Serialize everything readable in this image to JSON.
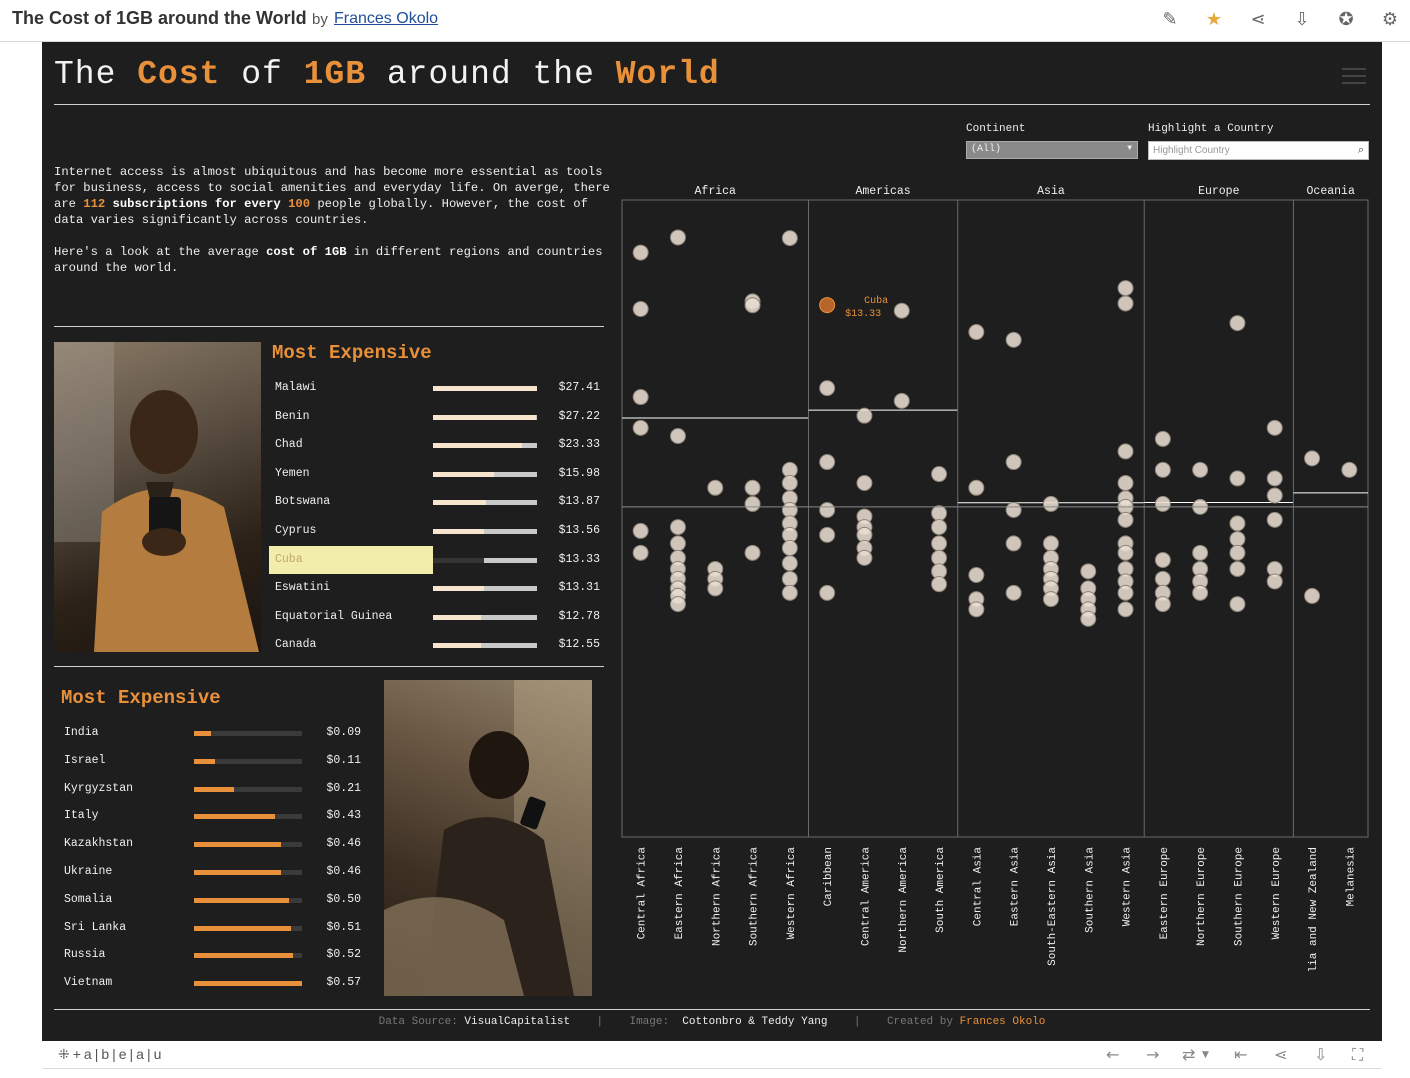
{
  "header": {
    "title": "The Cost of 1GB around the World",
    "by": "by",
    "author": "Frances Okolo"
  },
  "toolbar_icons": [
    "edit-icon",
    "star-icon",
    "share-icon",
    "download-icon",
    "badge-icon",
    "gear-icon"
  ],
  "dashboard": {
    "title_parts": [
      {
        "text": "The ",
        "hl": false
      },
      {
        "text": "Cost",
        "hl": true
      },
      {
        "text": " of ",
        "hl": false
      },
      {
        "text": "1GB",
        "hl": true
      },
      {
        "text": " around the ",
        "hl": false
      },
      {
        "text": "World",
        "hl": true
      }
    ],
    "intro_1": "Internet access is almost ubiquitous and has become more essential as tools for business, access to social amenities and everyday life. On averge, there are ",
    "intro_num1": "112",
    "intro_mid": " subscriptions for every ",
    "intro_num2": "100",
    "intro_2": " people globally. However, the cost of data varies significantly across countries.",
    "intro_3a": "Here's a look at the average ",
    "intro_3b": "cost of 1GB",
    "intro_3c": " in different regions and countries around the world.",
    "filters": {
      "continent_label": "Continent",
      "continent_value": "(All)",
      "highlight_label": "Highlight a Country",
      "highlight_placeholder": "Highlight Country"
    },
    "expensive": {
      "title": "Most Expensive",
      "max": 27.41,
      "rows": [
        {
          "country": "Malawi",
          "value": 27.41,
          "label": "$27.41"
        },
        {
          "country": "Benin",
          "value": 27.22,
          "label": "$27.22"
        },
        {
          "country": "Chad",
          "value": 23.33,
          "label": "$23.33"
        },
        {
          "country": "Yemen",
          "value": 15.98,
          "label": "$15.98"
        },
        {
          "country": "Botswana",
          "value": 13.87,
          "label": "$13.87"
        },
        {
          "country": "Cyprus",
          "value": 13.56,
          "label": "$13.56"
        },
        {
          "country": "Cuba",
          "value": 13.33,
          "label": "$13.33",
          "highlight": true
        },
        {
          "country": "Eswatini",
          "value": 13.31,
          "label": "$13.31"
        },
        {
          "country": "Equatorial Guinea",
          "value": 12.78,
          "label": "$12.78"
        },
        {
          "country": "Canada",
          "value": 12.55,
          "label": "$12.55"
        }
      ]
    },
    "cheapest": {
      "title": "Most Expensive",
      "max": 0.57,
      "rows": [
        {
          "country": "India",
          "value": 0.09,
          "label": "$0.09"
        },
        {
          "country": "Israel",
          "value": 0.11,
          "label": "$0.11"
        },
        {
          "country": "Kyrgyzstan",
          "value": 0.21,
          "label": "$0.21"
        },
        {
          "country": "Italy",
          "value": 0.43,
          "label": "$0.43"
        },
        {
          "country": "Kazakhstan",
          "value": 0.46,
          "label": "$0.46"
        },
        {
          "country": "Ukraine",
          "value": 0.46,
          "label": "$0.46"
        },
        {
          "country": "Somalia",
          "value": 0.5,
          "label": "$0.50"
        },
        {
          "country": "Sri Lanka",
          "value": 0.51,
          "label": "$0.51"
        },
        {
          "country": "Russia",
          "value": 0.52,
          "label": "$0.52"
        },
        {
          "country": "Vietnam",
          "value": 0.57,
          "label": "$0.57"
        }
      ]
    },
    "footer": {
      "source_label": "Data Source:",
      "source": "VisualCapitalist",
      "image_label": "Image:",
      "image": "Cottonbro & Teddy Yang",
      "created_label": "Created by",
      "created": "Frances Okolo"
    }
  },
  "chart_data": {
    "type": "scatter",
    "y_scale": "log",
    "ylim": [
      0.05,
      40
    ],
    "grid": false,
    "annotation": {
      "country": "Cuba",
      "label": "$13.33",
      "value": 13.33,
      "subregion": "Caribbean"
    },
    "continents": [
      {
        "name": "Africa",
        "subregions": [
          {
            "name": "Central Africa",
            "avg": 6.0,
            "values": [
              23.33,
              12.78,
              5.0,
              3.6,
              1.2,
              0.95
            ]
          },
          {
            "name": "Eastern Africa",
            "avg": 5.2,
            "values": [
              27.41,
              3.3,
              1.25,
              1.05,
              0.9,
              0.8,
              0.72,
              0.65,
              0.6,
              0.55
            ]
          },
          {
            "name": "Northern Africa",
            "avg": 1.5,
            "values": [
              1.9,
              0.8,
              0.72,
              0.65
            ]
          },
          {
            "name": "Southern Africa",
            "avg": 2.8,
            "values": [
              13.87,
              13.31,
              1.9,
              1.6,
              0.95
            ]
          },
          {
            "name": "Western Africa",
            "avg": 4.5,
            "values": [
              27.22,
              2.3,
              2.0,
              1.7,
              1.5,
              1.3,
              1.15,
              1.0,
              0.85,
              0.72,
              0.62
            ]
          }
        ]
      },
      {
        "name": "Americas",
        "subregions": [
          {
            "name": "Caribbean",
            "avg": 3.0,
            "values": [
              13.33,
              5.5,
              2.5,
              1.5,
              1.15,
              0.62
            ]
          },
          {
            "name": "Central America",
            "avg": 3.2,
            "values": [
              4.1,
              2.0,
              1.4,
              1.25,
              1.15,
              1.0,
              0.9
            ]
          },
          {
            "name": "Northern America",
            "avg": 9.0,
            "values": [
              12.55,
              4.8
            ]
          },
          {
            "name": "South America",
            "avg": 2.2,
            "values": [
              2.2,
              1.45,
              1.25,
              1.05,
              0.9,
              0.78,
              0.68
            ]
          }
        ]
      },
      {
        "name": "Asia",
        "subregions": [
          {
            "name": "Central Asia",
            "avg": 2.0,
            "values": [
              10.0,
              1.9,
              0.75,
              0.58,
              0.52
            ]
          },
          {
            "name": "Eastern Asia",
            "avg": 2.0,
            "values": [
              9.2,
              2.5,
              1.5,
              1.05,
              0.62
            ]
          },
          {
            "name": "South-Eastern Asia",
            "avg": 1.3,
            "values": [
              1.6,
              1.05,
              0.9,
              0.8,
              0.72,
              0.65,
              0.58
            ]
          },
          {
            "name": "Southern Asia",
            "avg": 0.8,
            "values": [
              0.78,
              0.65,
              0.58,
              0.52,
              0.47
            ]
          },
          {
            "name": "Western Asia",
            "avg": 2.0,
            "values": [
              15.98,
              13.56,
              2.8,
              2.0,
              1.7,
              1.55,
              1.35,
              1.05,
              0.95,
              0.8,
              0.7,
              0.62,
              0.52
            ]
          }
        ]
      },
      {
        "name": "Europe",
        "subregions": [
          {
            "name": "Eastern Europe",
            "avg": 1.6,
            "values": [
              3.2,
              2.3,
              1.6,
              0.88,
              0.72,
              0.62,
              0.55
            ]
          },
          {
            "name": "Northern Europe",
            "avg": 1.7,
            "values": [
              2.3,
              1.55,
              0.95,
              0.8,
              0.7,
              0.62
            ]
          },
          {
            "name": "Southern Europe",
            "avg": 1.6,
            "values": [
              11.0,
              2.1,
              1.3,
              1.1,
              0.95,
              0.8,
              0.55
            ]
          },
          {
            "name": "Western Europe",
            "avg": 1.6,
            "values": [
              3.6,
              2.1,
              1.75,
              1.35,
              0.8,
              0.7
            ]
          }
        ]
      },
      {
        "name": "Oceania",
        "subregions": [
          {
            "name": "Australia and New Zealand",
            "avg": 1.8,
            "values": [
              2.6,
              0.6
            ]
          },
          {
            "name": "Melanesia",
            "avg": 1.8,
            "values": [
              2.3
            ]
          }
        ]
      }
    ]
  }
}
